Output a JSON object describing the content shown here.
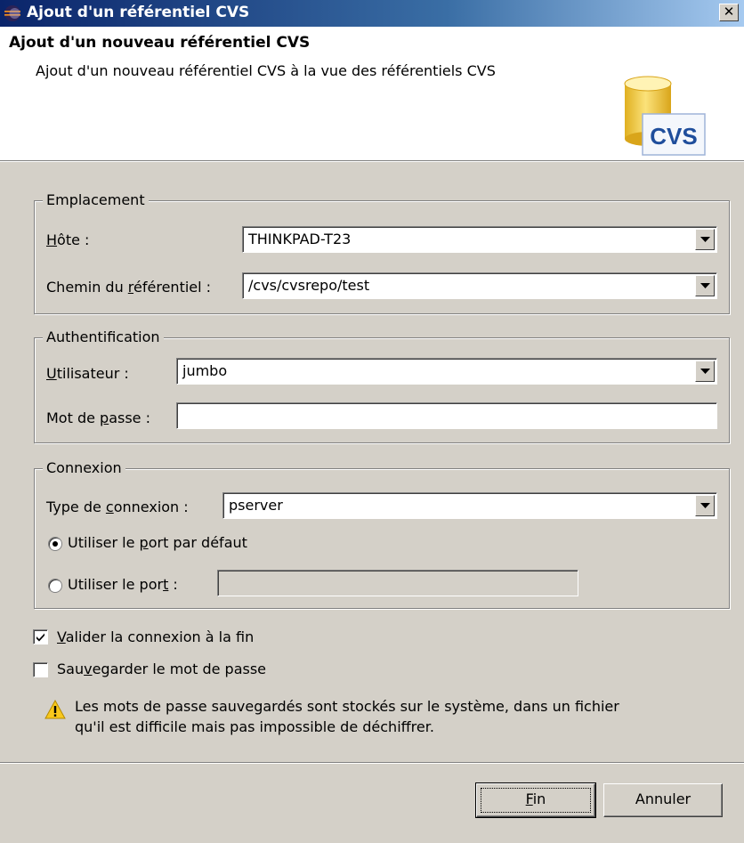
{
  "window": {
    "title": "Ajout d'un référentiel CVS",
    "close_glyph": "✕"
  },
  "banner": {
    "title": "Ajout d'un nouveau référentiel CVS",
    "description": "Ajout d'un nouveau référentiel CVS à la vue des référentiels CVS",
    "logo_text": "CVS"
  },
  "location": {
    "legend": "Emplacement",
    "host_label": {
      "pre": "",
      "mnemonic": "H",
      "post": "ôte :"
    },
    "host_value": "THINKPAD-T23",
    "path_label": {
      "pre": "Chemin du ",
      "mnemonic": "r",
      "post": "éférentiel :"
    },
    "path_value": "/cvs/cvsrepo/test"
  },
  "auth": {
    "legend": "Authentification",
    "user_label": {
      "pre": "",
      "mnemonic": "U",
      "post": "tilisateur :"
    },
    "user_value": "jumbo",
    "password_label": {
      "pre": "Mot de ",
      "mnemonic": "p",
      "post": "asse :"
    },
    "password_value": ""
  },
  "connection": {
    "legend": "Connexion",
    "type_label": {
      "pre": "Type de ",
      "mnemonic": "c",
      "post": "onnexion :"
    },
    "type_value": "pserver",
    "default_port_label": {
      "pre": "Utiliser le ",
      "mnemonic": "p",
      "post": "ort par défaut"
    },
    "default_port_selected": true,
    "custom_port_label": {
      "pre": "Utiliser le por",
      "mnemonic": "t",
      "post": " :"
    },
    "custom_port_value": ""
  },
  "options": {
    "validate_label": {
      "pre": "",
      "mnemonic": "V",
      "post": "alider la connexion à la fin"
    },
    "validate_checked": true,
    "save_password_label": {
      "pre": "Sau",
      "mnemonic": "v",
      "post": "egarder le mot de passe"
    },
    "save_password_checked": false,
    "warning_line1": "Les mots de passe sauvegardés sont stockés sur le système, dans un fichier",
    "warning_line2": "qu'il est difficile mais pas impossible de déchiffrer."
  },
  "buttons": {
    "finish": {
      "pre": "",
      "mnemonic": "F",
      "post": "in"
    },
    "cancel": "Annuler"
  },
  "icons": {
    "app": "eclipse-icon",
    "close": "close-icon",
    "logo": "cvs-repository-icon",
    "warning": "warning-icon",
    "dropdown": "chevron-down-icon"
  },
  "colors": {
    "titlebar_start": "#0a246a",
    "titlebar_end": "#a6caf0",
    "dialog_bg": "#d4d0c8",
    "cvs_blue": "#1f4e9c",
    "cylinder_yellow": "#f5d040"
  }
}
